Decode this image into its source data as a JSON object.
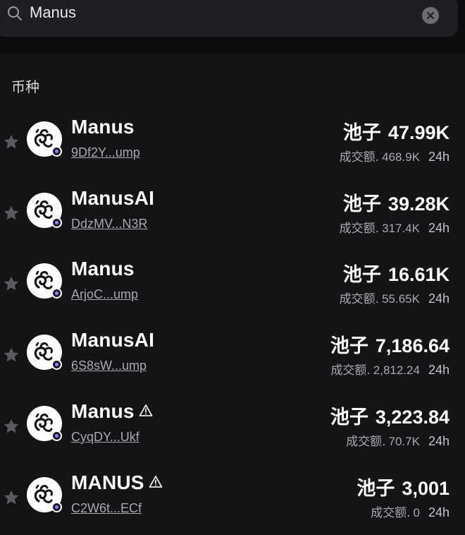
{
  "search": {
    "query": "Manus"
  },
  "section": {
    "title": "币种"
  },
  "tokens": [
    {
      "name": "Manus",
      "address": "9Df2Y...ump",
      "pool_label": "池子",
      "pool": "47.99K",
      "vol_label": "成交额.",
      "volume": "468.9K",
      "period": "24h",
      "warning": false
    },
    {
      "name": "ManusAI",
      "address": "DdzMV...N3R",
      "pool_label": "池子",
      "pool": "39.28K",
      "vol_label": "成交额.",
      "volume": "317.4K",
      "period": "24h",
      "warning": false
    },
    {
      "name": "Manus",
      "address": "ArjoC...ump",
      "pool_label": "池子",
      "pool": "16.61K",
      "vol_label": "成交额.",
      "volume": "55.65K",
      "period": "24h",
      "warning": false
    },
    {
      "name": "ManusAI",
      "address": "6S8sW...ump",
      "pool_label": "池子",
      "pool": "7,186.64",
      "vol_label": "成交额.",
      "volume": "2,812.24",
      "period": "24h",
      "warning": false
    },
    {
      "name": "Manus",
      "address": "CyqDY...Ukf",
      "pool_label": "池子",
      "pool": "3,223.84",
      "vol_label": "成交额.",
      "volume": "70.7K",
      "period": "24h",
      "warning": true
    },
    {
      "name": "MANUS",
      "address": "C2W6t...ECf",
      "pool_label": "池子",
      "pool": "3,001",
      "vol_label": "成交额.",
      "volume": "0",
      "period": "24h",
      "warning": true
    }
  ],
  "colors": {
    "background": "#141416",
    "search_bg": "#1f1f23",
    "muted_text": "#a9a9ae",
    "chain_badge": "#9b7cf5"
  },
  "icons": {
    "search": "search-icon",
    "clear": "clear-icon",
    "favorite": "star-icon",
    "warning": "warning-icon",
    "token_logo": "manus-logo-icon",
    "chain": "solana-chain-icon"
  }
}
